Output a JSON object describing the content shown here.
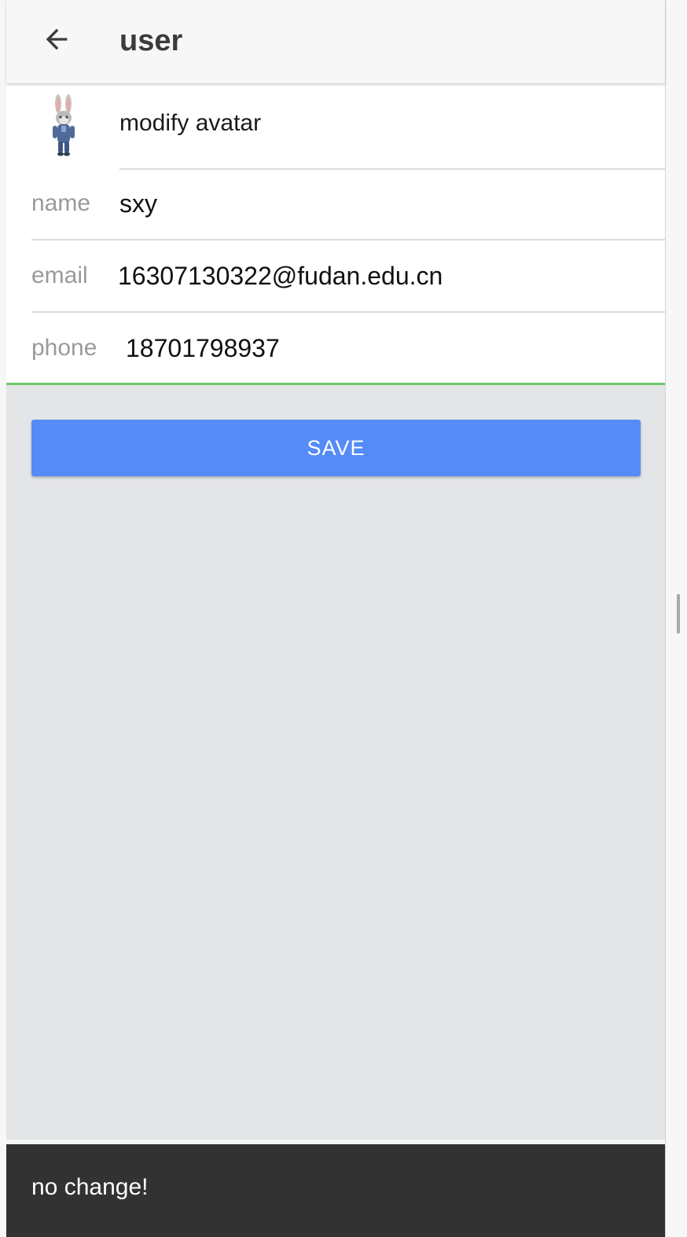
{
  "app_bar": {
    "title": "user",
    "back_icon": "arrow-back-icon"
  },
  "avatar_row": {
    "label": "modify avatar",
    "avatar_icon": "bunny-avatar-image"
  },
  "fields": [
    {
      "label": "name",
      "value": "sxy"
    },
    {
      "label": "email",
      "value": "16307130322@fudan.edu.cn"
    },
    {
      "label": "phone",
      "value": "18701798937"
    }
  ],
  "actions": {
    "save_label": "SAVE"
  },
  "snackbar": {
    "message": "no change!"
  },
  "colors": {
    "primary_button": "#558bf7",
    "focused_underline": "#6cc96c",
    "snackbar_bg": "#323232",
    "page_bg": "#e4e5e7"
  }
}
